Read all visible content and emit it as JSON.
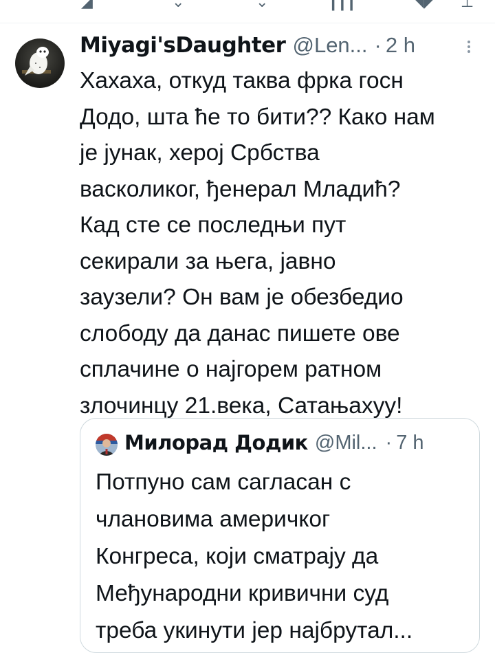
{
  "tweet": {
    "display_name": "Miyagi'sDaughter",
    "handle": "@Len...",
    "separator": "·",
    "time": "2 h",
    "lines": [
      "Хахаха, откуд таква фрка госн",
      "Додо, шта ће то бити?? Како нам",
      "је јунак, херој Србства",
      "васколиког, ђенерал Младић?",
      "Кад сте се последњи пут",
      "секирали за њега, јавно",
      "заузели? Он вам је обезбедио",
      "слободу да данас пишете ове",
      "сплачине о најгорем ратном",
      "злочинцу 21.века, Сатањахуу!"
    ]
  },
  "quoted": {
    "display_name": "Милорад Додик",
    "handle": "@Mil...",
    "separator": "·",
    "time": "7 h",
    "lines": [
      "Потпуно сам сагласан с",
      "члановима америчког",
      "Конгреса, који сматрају да",
      "Међународни кривични суд",
      "треба укинути јер најбрутал..."
    ]
  },
  "icons": [
    "reply-icon",
    "retweet-icon",
    "like-icon",
    "views-icon",
    "bookmark-icon",
    "share-icon",
    "more-icon"
  ],
  "colors": {
    "text": "#0f1419",
    "secondary": "#536471",
    "border": "#cfd9de"
  }
}
